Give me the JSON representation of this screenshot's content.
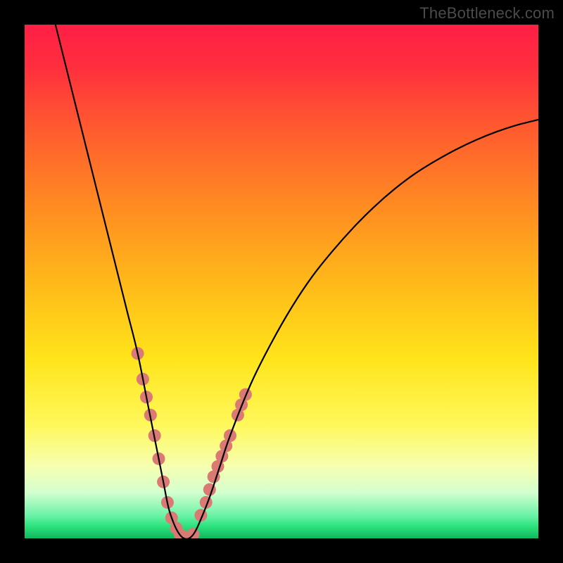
{
  "watermark": "TheBottleneck.com",
  "colors": {
    "frame": "#000000",
    "curve": "#000000",
    "marker_fill": "#db7a74",
    "watermark": "#4b4b4b",
    "gradient_stops": [
      {
        "offset": 0.0,
        "color": "#ff1f45"
      },
      {
        "offset": 0.08,
        "color": "#ff2e3e"
      },
      {
        "offset": 0.2,
        "color": "#ff5a2f"
      },
      {
        "offset": 0.35,
        "color": "#ff8a22"
      },
      {
        "offset": 0.5,
        "color": "#ffb81a"
      },
      {
        "offset": 0.65,
        "color": "#ffe41a"
      },
      {
        "offset": 0.78,
        "color": "#fff85c"
      },
      {
        "offset": 0.86,
        "color": "#f6ffb0"
      },
      {
        "offset": 0.91,
        "color": "#d4ffcf"
      },
      {
        "offset": 0.955,
        "color": "#6cf3a8"
      },
      {
        "offset": 0.975,
        "color": "#2fe47f"
      },
      {
        "offset": 1.0,
        "color": "#0fb85e"
      }
    ]
  },
  "chart_data": {
    "type": "line",
    "title": "",
    "xlabel": "",
    "ylabel": "",
    "xlim": [
      0,
      100
    ],
    "ylim": [
      0,
      100
    ],
    "grid": false,
    "series": [
      {
        "name": "bottleneck-curve",
        "x": [
          6,
          8,
          10,
          12,
          14,
          16,
          18,
          20,
          22,
          24,
          25,
          26,
          27,
          28,
          29,
          30,
          31,
          32,
          33,
          34,
          36,
          38,
          40,
          44,
          48,
          52,
          56,
          60,
          64,
          68,
          72,
          76,
          80,
          84,
          88,
          92,
          96,
          100
        ],
        "y": [
          100,
          92,
          84,
          76,
          68,
          60,
          52,
          44,
          36,
          26,
          21,
          16,
          11,
          6,
          3,
          1,
          0,
          0,
          1,
          3,
          8,
          14,
          20,
          30,
          38,
          45,
          51,
          56,
          60.5,
          64.5,
          68,
          71,
          73.5,
          75.7,
          77.6,
          79.2,
          80.5,
          81.5
        ]
      }
    ],
    "markers": {
      "name": "highlighted-points",
      "x": [
        22.0,
        23.0,
        23.7,
        24.5,
        25.3,
        26.1,
        27.0,
        27.8,
        28.6,
        29.5,
        30.3,
        31.2,
        32.0,
        32.8,
        34.3,
        35.3,
        36.0,
        36.8,
        37.6,
        38.4,
        39.2,
        40.0,
        41.5,
        42.2,
        43.0
      ],
      "y": [
        36.0,
        31.0,
        27.5,
        24.0,
        20.0,
        15.5,
        11.0,
        7.0,
        4.0,
        2.0,
        0.7,
        0.2,
        0.2,
        0.8,
        4.5,
        7.0,
        9.5,
        12.0,
        14.0,
        16.0,
        18.0,
        20.0,
        24.0,
        26.0,
        28.0
      ],
      "radius_px": 9
    }
  }
}
